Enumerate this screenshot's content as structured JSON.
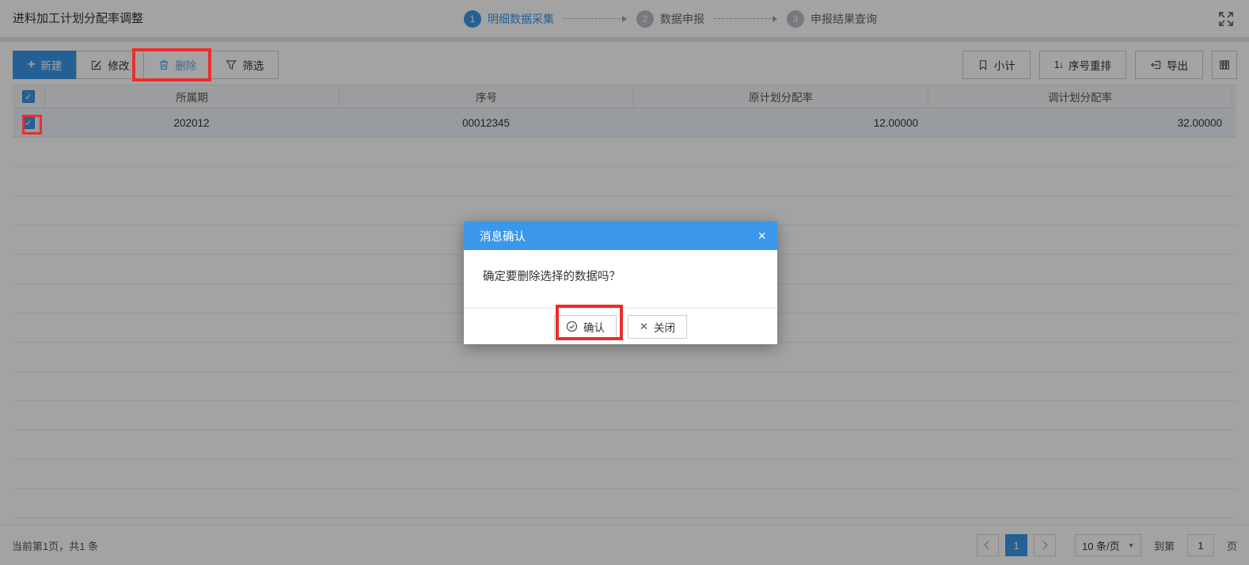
{
  "page": {
    "title": "进料加工计划分配率调整"
  },
  "steps": [
    {
      "num": "1",
      "label": "明细数据采集"
    },
    {
      "num": "2",
      "label": "数据申报"
    },
    {
      "num": "3",
      "label": "申报结果查询"
    }
  ],
  "toolbar": {
    "new": "新建",
    "modify": "修改",
    "delete": "删除",
    "filter": "筛选",
    "subtotal": "小计",
    "reorder": "序号重排",
    "export": "导出"
  },
  "table": {
    "columns": [
      "所属期",
      "序号",
      "原计划分配率",
      "调计划分配率"
    ],
    "rows": [
      {
        "period": "202012",
        "serial": "00012345",
        "original_rate": "12.00000",
        "adjusted_rate": "32.00000"
      }
    ]
  },
  "dialog": {
    "title": "消息确认",
    "message": "确定要删除选择的数据吗？",
    "confirm": "确认",
    "close": "关闭"
  },
  "pagination": {
    "summary": "当前第1页，共1 条",
    "current_page": "1",
    "page_size": "10 条/页",
    "goto_label": "到第",
    "goto_value": "1",
    "page_unit": "页"
  },
  "icons": {
    "check": "✓",
    "close_x": "×",
    "cross": "✕",
    "plus": "+",
    "sort": "1↓",
    "caret": "▼"
  },
  "colors": {
    "accent": "#3a96e8",
    "annotation": "#ec2d2d",
    "selected_row": "#eef4fb"
  }
}
